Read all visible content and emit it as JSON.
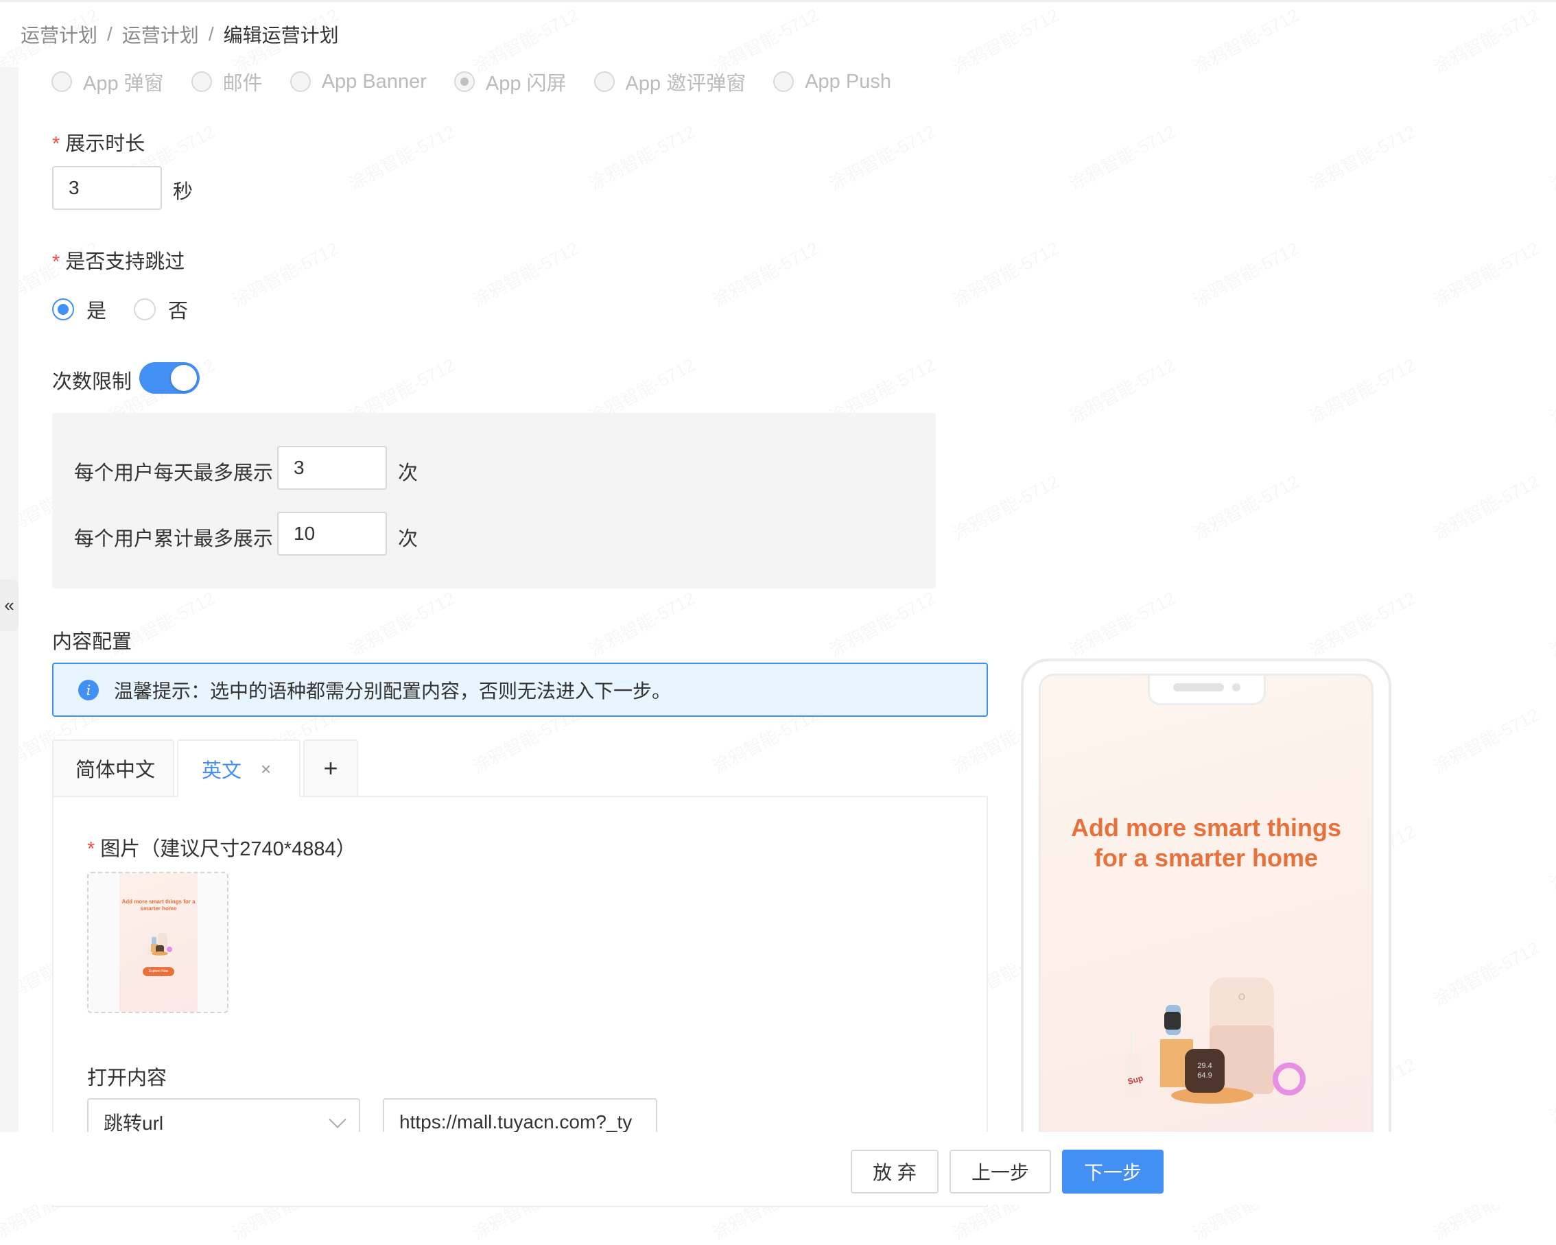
{
  "breadcrumb": [
    "运营计划",
    "运营计划",
    "编辑运营计划"
  ],
  "breadcrumb_separator": "/",
  "channel_options": [
    {
      "label": "App 弹窗",
      "selected": false
    },
    {
      "label": "邮件",
      "selected": false
    },
    {
      "label": "App Banner",
      "selected": false
    },
    {
      "label": "App 闪屏",
      "selected": true
    },
    {
      "label": "App 邀评弹窗",
      "selected": false
    },
    {
      "label": "App Push",
      "selected": false
    }
  ],
  "display_duration": {
    "required_mark": "*",
    "label": "展示时长",
    "value": "3",
    "unit": "秒"
  },
  "skip_support": {
    "required_mark": "*",
    "label": "是否支持跳过",
    "options": [
      {
        "label": "是",
        "selected": true
      },
      {
        "label": "否",
        "selected": false
      }
    ]
  },
  "frequency_limit": {
    "label": "次数限制",
    "enabled": true,
    "daily_label": "每个用户每天最多展示",
    "daily_value": "3",
    "daily_unit": "次",
    "total_label": "每个用户累计最多展示",
    "total_value": "10",
    "total_unit": "次"
  },
  "content_config": {
    "title": "内容配置",
    "alert_text": "温馨提示：选中的语种都需分别配置内容，否则无法进入下一步。",
    "tabs": [
      {
        "label": "简体中文",
        "active": false,
        "closable": false
      },
      {
        "label": "英文",
        "active": true,
        "closable": true
      }
    ],
    "add_tab_label": "+",
    "close_tab_glyph": "×",
    "image_field": {
      "required_mark": "*",
      "label": "图片（建议尺寸2740*4884）",
      "thumb_headline": "Add more smart things for a smarter home",
      "thumb_button": "Explore Now"
    },
    "open_content": {
      "label": "打开内容",
      "select_value": "跳转url",
      "url_value": "https://mall.tuyacn.com?_ty"
    }
  },
  "preview": {
    "headline_line1": "Add more smart things",
    "headline_line2": "for a smarter home"
  },
  "footer": {
    "discard_label": "放 弃",
    "prev_label": "上一步",
    "next_label": "下一步"
  },
  "collapse_glyph": "«",
  "watermark_text": "涂鸦智能-5712",
  "colors": {
    "primary": "#4390f5",
    "required": "#f5504a",
    "headline": "#e8703a",
    "alert_bg": "#e8f4fe"
  }
}
